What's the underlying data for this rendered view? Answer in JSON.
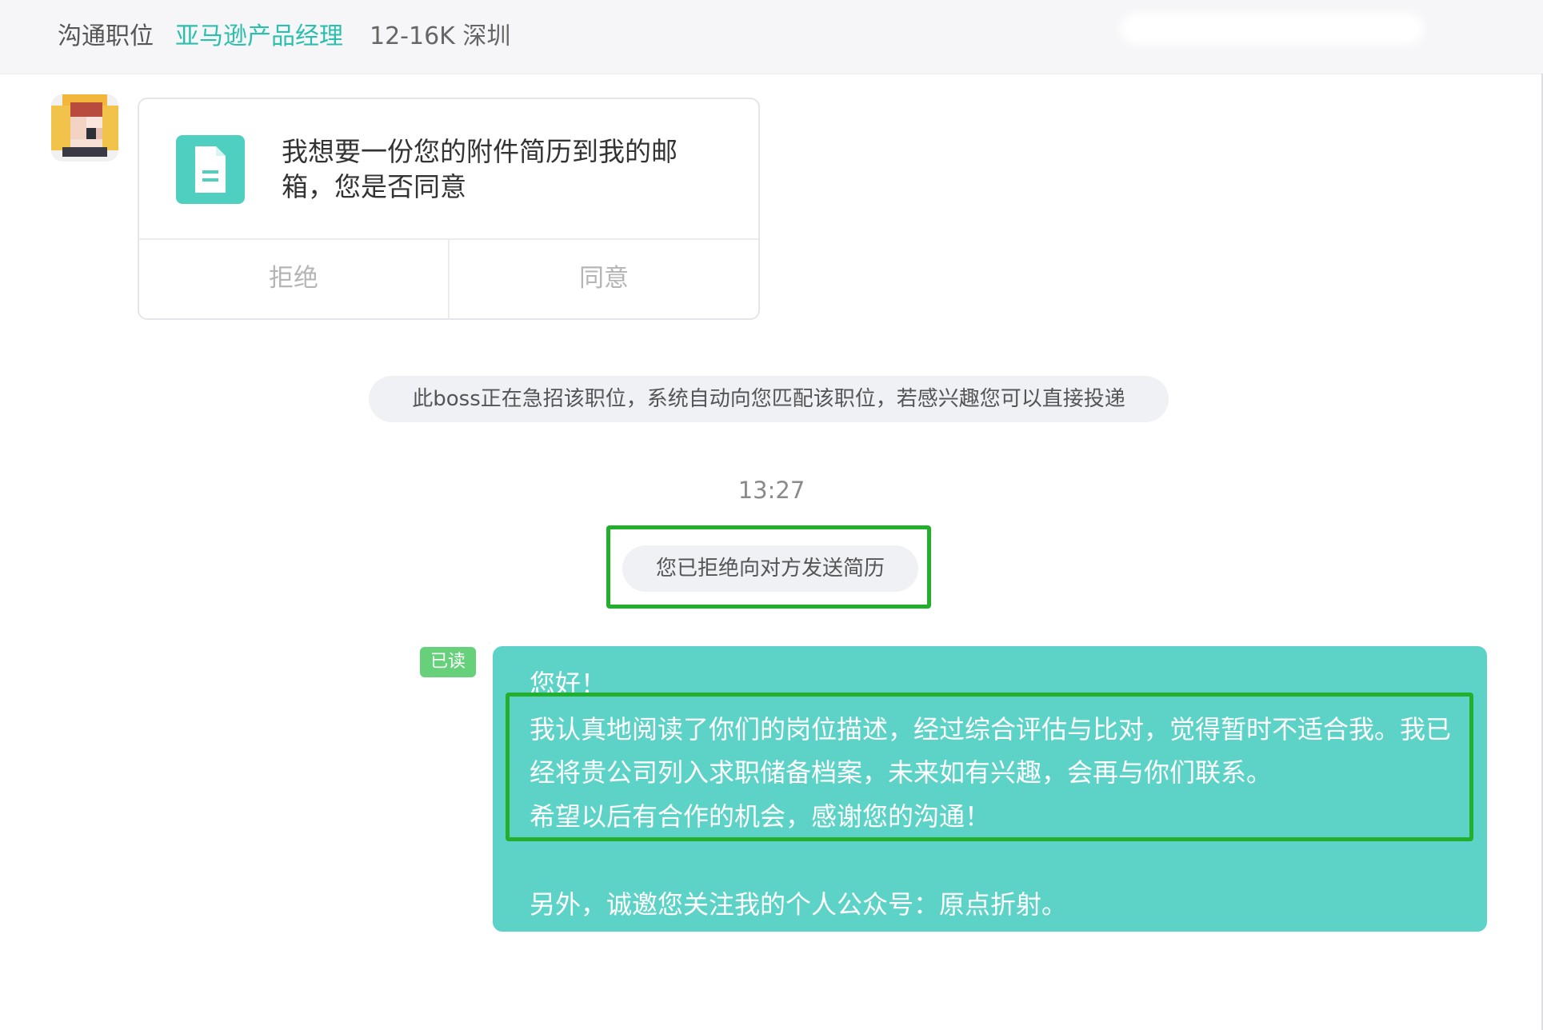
{
  "header": {
    "label": "沟通职位",
    "job_title": "亚马逊产品经理",
    "meta": "12-16K 深圳"
  },
  "request_card": {
    "icon": "document-icon",
    "text": "我想要一份您的附件简历到我的邮箱，您是否同意",
    "reject_label": "拒绝",
    "accept_label": "同意"
  },
  "system_notice": "此boss正在急招该职位，系统自动向您匹配该职位，若感兴趣您可以直接投递",
  "timestamp": "13:27",
  "rejected_notice": "您已拒绝向对方发送简历",
  "read_badge": "已读",
  "message": {
    "lines": [
      "您好！",
      "我认真地阅读了你们的岗位描述，经过综合评估与比对，觉得暂时不适合我。我已",
      "经将贵公司列入求职储备档案，未来如有兴趣，会再与你们联系。",
      "希望以后有合作的机会，感谢您的沟通！",
      "另外，诚邀您关注我的个人公众号：原点折射。"
    ]
  },
  "colors": {
    "accent": "#2cbfae",
    "bubble": "#5dd3c7",
    "highlight": "#22b02c",
    "read_badge": "#66d07a"
  }
}
